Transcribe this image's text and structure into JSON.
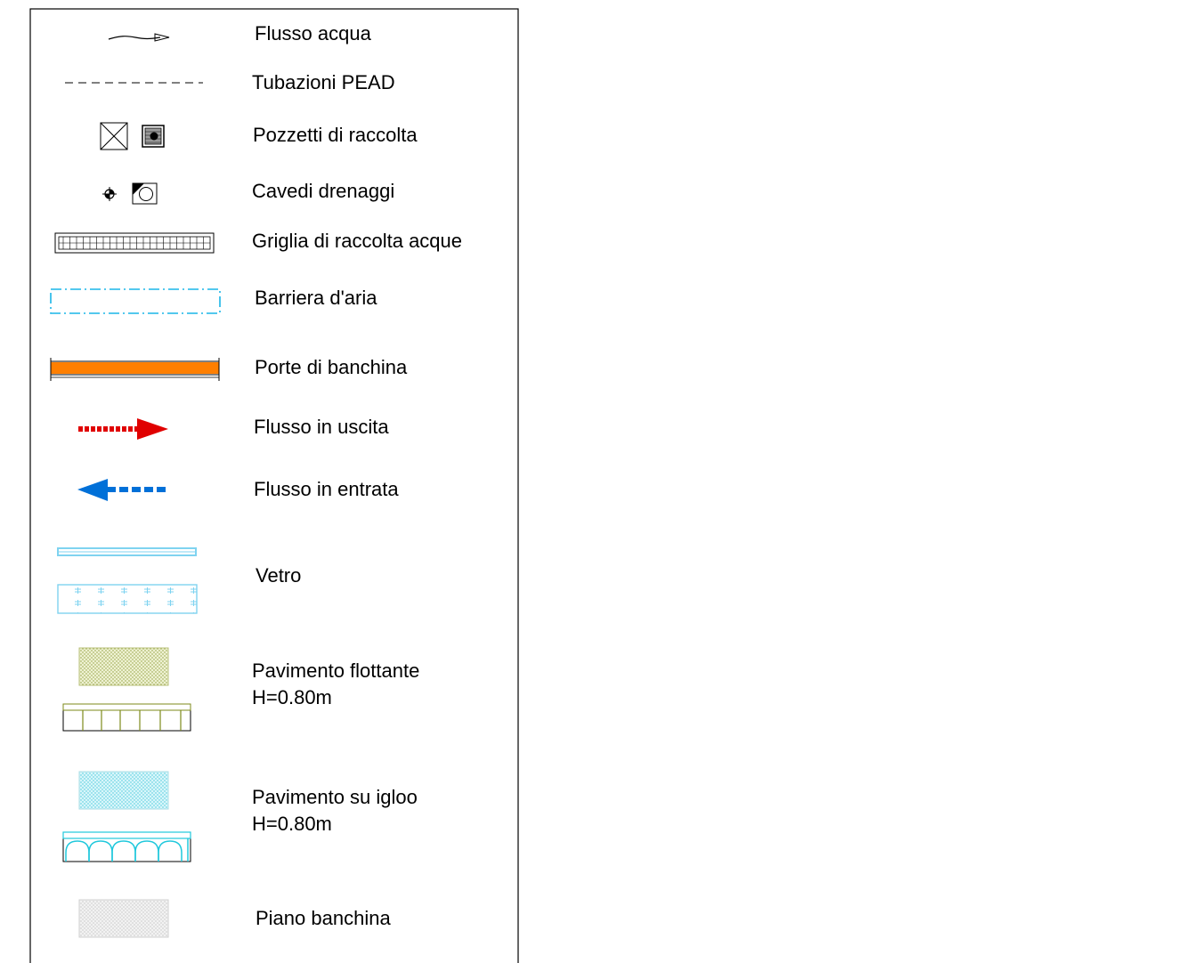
{
  "legend": {
    "items": [
      {
        "id": "water-flow",
        "label": "Flusso acqua",
        "symbol": "wavy-arrow-icon"
      },
      {
        "id": "pead-pipes",
        "label": "Tubazioni PEAD",
        "symbol": "dashed-line-icon"
      },
      {
        "id": "collection-wells",
        "label": "Pozzetti di raccolta",
        "symbol": "crossed-box-icon"
      },
      {
        "id": "drainage-shafts",
        "label": "Cavedi drenaggi",
        "symbol": "target-circle-icon"
      },
      {
        "id": "water-grate",
        "label": "Griglia di raccolta acque",
        "symbol": "grate-icon"
      },
      {
        "id": "air-barrier",
        "label": "Barriera d'aria",
        "symbol": "dash-dot-rectangle-icon"
      },
      {
        "id": "platform-doors",
        "label": "Porte di banchina",
        "symbol": "orange-bar-icon"
      },
      {
        "id": "exit-flow",
        "label": "Flusso in uscita",
        "symbol": "red-right-arrow-icon"
      },
      {
        "id": "entry-flow",
        "label": "Flusso in entrata",
        "symbol": "blue-left-arrow-icon"
      },
      {
        "id": "glass",
        "label": "Vetro",
        "symbol": "glass-panel-icon"
      },
      {
        "id": "floating-floor",
        "label": "Pavimento flottante\nH=0.80m",
        "symbol": "floating-floor-icon"
      },
      {
        "id": "igloo-floor",
        "label": "Pavimento su igloo\nH=0.80m",
        "symbol": "igloo-floor-icon"
      },
      {
        "id": "platform-level",
        "label": "Piano banchina",
        "symbol": "platform-hatch-icon"
      }
    ]
  },
  "colors": {
    "border": "#000000",
    "air_barrier": "#1ab6e8",
    "doors_fill": "#ff7f00",
    "exit_arrow": "#e00000",
    "entry_arrow": "#0070d8",
    "glass": "#7fd3f0",
    "floating_fill": "#e6ebc4",
    "floating_frame": "#7d8a1a",
    "igloo_fill": "#c8f0f5",
    "igloo_arch": "#20c8dc",
    "platform_fill": "#ececec"
  }
}
